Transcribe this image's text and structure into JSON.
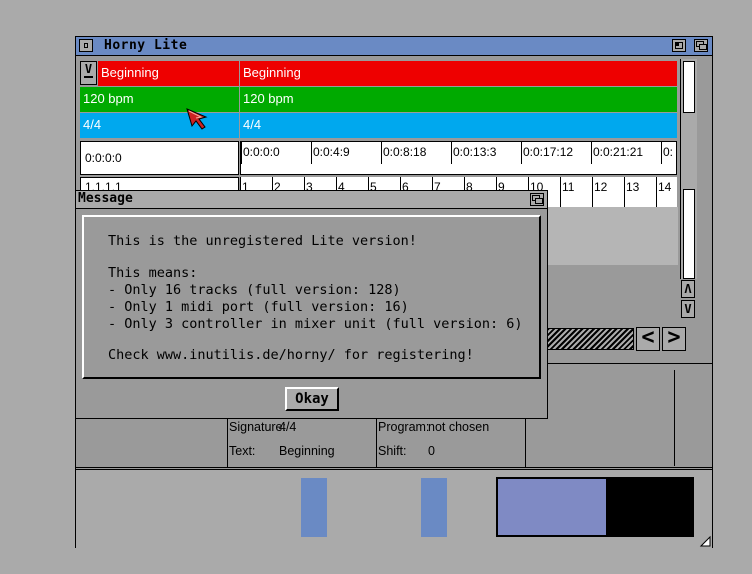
{
  "window": {
    "title": "Horny Lite"
  },
  "rows": {
    "marker_left": "Beginning",
    "marker_right": "Beginning",
    "tempo_left": "120 bpm",
    "tempo_right": "120 bpm",
    "signature_left": "4/4",
    "signature_right": "4/4",
    "time_position": "0:0:0:0",
    "bar_position": "1.1.1.1",
    "time_ticks": [
      "0:0:0:0",
      "0:0:4:9",
      "0:0:8:18",
      "0:0:13:3",
      "0:0:17:12",
      "0:0:21:21",
      "0:"
    ],
    "bar_ticks": [
      "1",
      "2",
      "3",
      "4",
      "5",
      "6",
      "7",
      "8",
      "9",
      "10",
      "11",
      "12",
      "13",
      "14"
    ]
  },
  "info": {
    "signature_label": "Signature:",
    "signature_value": "4/4",
    "text_label": "Text:",
    "text_value": "Beginning",
    "program_label": "Program:",
    "program_value": "not chosen",
    "shift_label": "Shift:",
    "shift_value": "0"
  },
  "dialog": {
    "title": "Message",
    "lines": [
      "This is the unregistered Lite version!",
      "",
      "This means:",
      "- Only 16 tracks (full version: 128)",
      "- Only 1 midi port (full version: 16)",
      "- Only 3 controller in mixer unit (full version: 6)",
      "",
      "Check www.inutilis.de/horny/ for registering!"
    ],
    "okay_label": "Okay"
  },
  "colors": {
    "desktop": "#aaaaaa",
    "titlebar": "#6a8ac4",
    "marker_red": "#ee0000",
    "tempo_green": "#00aa00",
    "signature_blue": "#00a8ee"
  }
}
